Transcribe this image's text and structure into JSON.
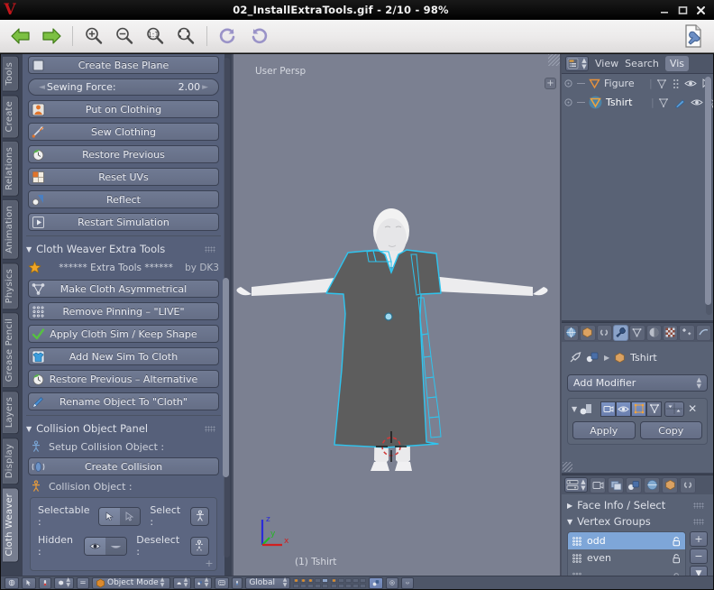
{
  "window": {
    "title": "02_InstallExtraTools.gif - 2/10 - 98%",
    "logo": "v-logo",
    "buttons": [
      {
        "name": "minimize-button",
        "label": "—"
      },
      {
        "name": "maximize-button",
        "label": "□"
      },
      {
        "name": "close-button",
        "label": "✕"
      }
    ]
  },
  "toolbar": {
    "items": [
      {
        "name": "previous-image-button",
        "icon": "arrow-left-icon",
        "label": "Previous"
      },
      {
        "name": "next-image-button",
        "icon": "arrow-right-icon",
        "label": "Next"
      },
      {
        "name": "zoom-in-button",
        "icon": "zoom-in-icon",
        "label": "Zoom In"
      },
      {
        "name": "zoom-out-button",
        "icon": "zoom-out-icon",
        "label": "Zoom Out"
      },
      {
        "name": "zoom-actual-button",
        "icon": "zoom-1-1-icon",
        "label": "Actual Size"
      },
      {
        "name": "zoom-fit-button",
        "icon": "zoom-fit-icon",
        "label": "Fit to Window"
      },
      {
        "name": "rotate-left-button",
        "icon": "rotate-left-icon",
        "label": "Rotate Left"
      },
      {
        "name": "rotate-right-button",
        "icon": "rotate-right-icon",
        "label": "Rotate Right"
      },
      {
        "name": "settings-button",
        "icon": "wrench-document-icon",
        "label": "Settings"
      }
    ]
  },
  "blender": {
    "left_tabs": [
      {
        "label": "Tools",
        "active": false
      },
      {
        "label": "Create",
        "active": false
      },
      {
        "label": "Relations",
        "active": false
      },
      {
        "label": "Animation",
        "active": false
      },
      {
        "label": "Physics",
        "active": false
      },
      {
        "label": "Grease Pencil",
        "active": false
      },
      {
        "label": "Layers",
        "active": false
      },
      {
        "label": "Display",
        "active": false
      },
      {
        "label": "Cloth Weaver",
        "active": true
      }
    ],
    "tool_panel": {
      "create_base_plane": "Create Base Plane",
      "sewing_force_label": "Sewing Force:",
      "sewing_force_value": "2.00",
      "buttons": [
        {
          "label": "Put on Clothing",
          "icon": "person-shirt-icon"
        },
        {
          "label": "Sew Clothing",
          "icon": "needle-icon"
        },
        {
          "label": "Restore Previous",
          "icon": "undo-clock-icon"
        },
        {
          "label": "Reset UVs",
          "icon": "uv-grid-icon"
        },
        {
          "label": "Reflect",
          "icon": "mirror-icon"
        },
        {
          "label": "Restart Simulation",
          "icon": "play-icon"
        }
      ],
      "extra_tools_panel": {
        "title": "Cloth Weaver Extra Tools",
        "banner": "****** Extra Tools ******",
        "author": "by DK3",
        "buttons": [
          {
            "label": "Make Cloth Asymmetrical",
            "icon": "mesh-triangle-icon"
          },
          {
            "label": "Remove Pinning – \"LIVE\"",
            "icon": "vertex-grid-icon"
          },
          {
            "label": "Apply Cloth Sim / Keep Shape",
            "icon": "checkmark-icon"
          },
          {
            "label": "Add New Sim To Cloth",
            "icon": "tshirt-icon"
          },
          {
            "label": "Restore Previous – Alternative",
            "icon": "undo-clock-icon"
          },
          {
            "label": "Rename Object To \"Cloth\"",
            "icon": "pencil-icon"
          }
        ]
      },
      "collision_panel": {
        "title": "Collision Object Panel",
        "setup_label": "Setup Collision Object :",
        "create_collision": "Create Collision",
        "object_label": "Collision Object :",
        "selectable_label": "Selectable :",
        "select_label": "Select :",
        "hidden_label": "Hidden :",
        "deselect_label": "Deselect :"
      }
    },
    "viewport": {
      "perspective_label": "User Persp",
      "object_label": "(1) Tshirt",
      "axis": {
        "x": "x",
        "y": "y",
        "z": "z"
      },
      "cloth_color": "#2fc4ee",
      "mesh_color": "#5d5d5d",
      "background": "#7b8091"
    },
    "outliner": {
      "menus": [
        "View",
        "Search",
        "Vis"
      ],
      "rows": [
        {
          "name": "Figure",
          "selected": false
        },
        {
          "name": "Tshirt",
          "selected": true
        }
      ]
    },
    "properties": {
      "tabs": [
        {
          "name": "world-tab",
          "active": false
        },
        {
          "name": "object-tab",
          "active": false
        },
        {
          "name": "constraints-tab",
          "active": false
        },
        {
          "name": "modifier-tab",
          "active": true
        },
        {
          "name": "data-tab",
          "active": false
        },
        {
          "name": "material-tab",
          "active": false
        },
        {
          "name": "texture-tab",
          "active": false
        },
        {
          "name": "particles-tab",
          "active": false
        },
        {
          "name": "physics-tab",
          "active": false
        }
      ],
      "breadcrumb_object": "Tshirt",
      "add_modifier": "Add Modifier",
      "apply_label": "Apply",
      "copy_label": "Copy"
    },
    "properties2": {
      "face_info_panel": "Face Info / Select",
      "vertex_groups_panel": "Vertex Groups",
      "vertex_groups": [
        {
          "label": "odd",
          "selected": true
        },
        {
          "label": "even",
          "selected": false
        }
      ],
      "add_label": "+",
      "remove_label": "−"
    },
    "bottom_header": {
      "mode": "Object Mode",
      "orientation": "Global"
    }
  }
}
